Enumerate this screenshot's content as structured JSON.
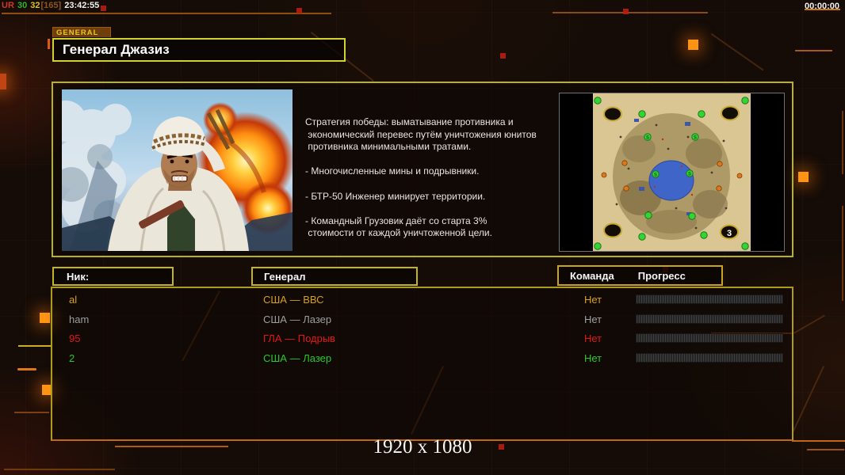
{
  "hud": {
    "debug_segments": [
      {
        "text": "UR",
        "color": "#c83c28"
      },
      {
        "text": " 30",
        "color": "#2fb42f"
      },
      {
        "text": " 32",
        "color": "#d8c020"
      },
      {
        "text": "[165]",
        "color": "#8a5520"
      },
      {
        "text": " 23:42:55",
        "color": "#f0f0f0"
      }
    ],
    "timer": "00:00:00",
    "resolution": "1920 x 1080"
  },
  "header": {
    "tab_label": "GENERAL",
    "title": "Генерал Джазиз"
  },
  "briefing": {
    "strategy": "Стратегия победы: выматывание противника и\n экономический перевес путём уничтожения юнитов\n противника минимальными тратами.\n\n- Многочисленные мины и подрывники.\n\n- БТР-50 Инженер минирует территории.\n\n- Командный Грузовик даёт со старта 3%\n стоимости от каждой уничтоженной цели."
  },
  "minimap": {
    "badge": "3"
  },
  "lobby": {
    "columns": {
      "nick": "Ник:",
      "general": "Генерал",
      "team": "Команда",
      "progress": "Прогресс"
    },
    "players": [
      {
        "nick": "al",
        "general": "США — ВВС",
        "team": "Нет",
        "color": "#d8a018",
        "progress_percent": 0
      },
      {
        "nick": "ham",
        "general": "США — Лазер",
        "team": "Нет",
        "color": "#9f9f9f",
        "progress_percent": 0
      },
      {
        "nick": "95",
        "general": "ГЛА — Подрыв",
        "team": "Нет",
        "color": "#e21818",
        "progress_percent": 0
      },
      {
        "nick": "2",
        "general": "США — Лазер",
        "team": "Нет",
        "color": "#2bc92b",
        "progress_percent": 0
      }
    ]
  },
  "colors": {
    "accent_yellow": "#c9c01e",
    "accent_orange": "#e07818",
    "panel_bg": "#150c07"
  }
}
